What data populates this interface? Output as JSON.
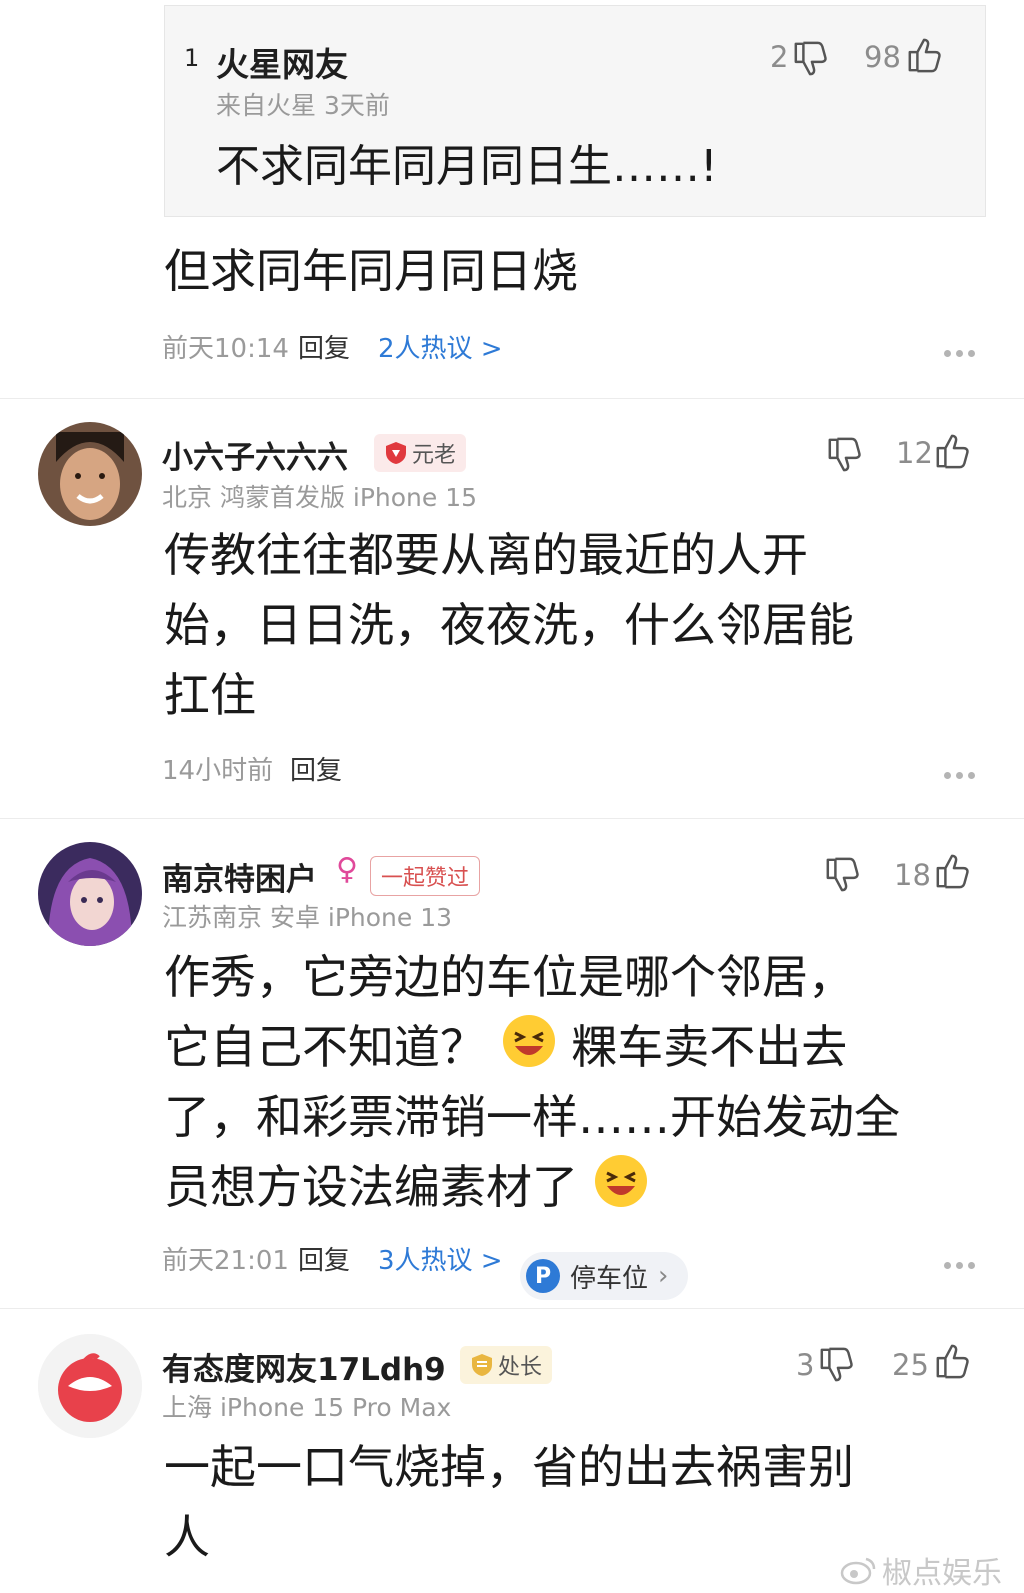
{
  "quoted": {
    "rank": "1",
    "user": "火星网友",
    "meta": "来自火星  3天前",
    "text": "不求同年同月同日生……!",
    "dislikes": "2",
    "likes": "98"
  },
  "comments": [
    {
      "text": "但求同年同月同日烧",
      "time": "前天10:14",
      "reply": "回复",
      "hot": "2人热议 >"
    },
    {
      "user": "小六子六六六",
      "badge": "元老",
      "sub": "北京  鸿蒙首发版  iPhone 15",
      "text_lines": [
        "传教往往都要从离的最近的人开",
        "始，日日洗，夜夜洗，什么邻居能",
        "扛住"
      ],
      "time": "14小时前",
      "reply": "回复",
      "likes": "12"
    },
    {
      "user": "南京特困户",
      "gender": "♀",
      "badge": "一起赞过",
      "sub": "江苏南京  安卓  iPhone 13",
      "text_lines": [
        "作秀，它旁边的车位是哪个邻居，",
        "它自己不知道？",
        "粿车卖不出去",
        "了，和彩票滞销一样……开始发动全",
        "员想方设法编素材了"
      ],
      "time": "前天21:01",
      "reply": "回复",
      "hot": "3人热议 >",
      "tag": "停车位",
      "tag_icon": "P",
      "likes": "18"
    },
    {
      "user": "有态度网友17Ldh9",
      "badge": "处长",
      "sub": "上海  iPhone 15 Pro Max",
      "text_lines": [
        "一起一口气烧掉，省的出去祸害别",
        "人"
      ],
      "dislikes": "3",
      "likes": "25"
    }
  ],
  "watermark": "椒点娱乐",
  "colors": {
    "link": "#2e7ad6",
    "muted": "#9a9a9a",
    "badge_red": "#e0393e",
    "badge_gold": "#e9b640"
  }
}
